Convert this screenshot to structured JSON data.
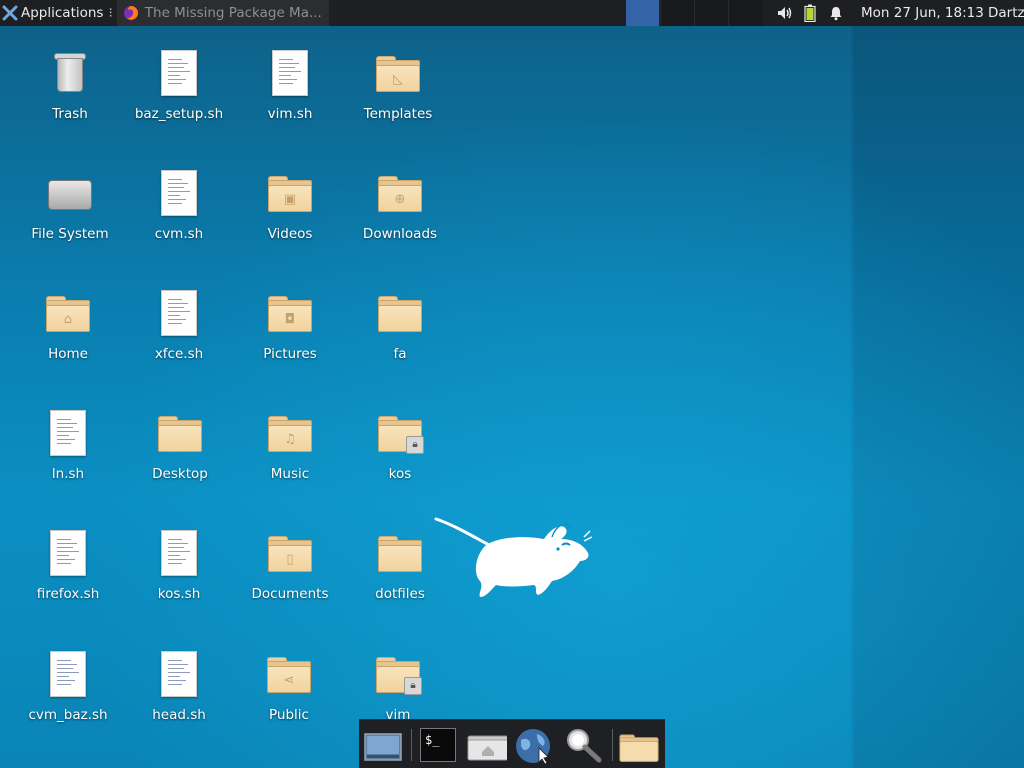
{
  "panel": {
    "applications_label": "Applications",
    "task_title": "The Missing Package Ma...",
    "clock": "Mon 27 Jun, 18:13",
    "user": "Dartz",
    "active_workspace": 1
  },
  "desktop": {
    "icons": {
      "trash": "Trash",
      "baz_setup": "baz_setup.sh",
      "vim_sh": "vim.sh",
      "templates": "Templates",
      "file_system": "File System",
      "cvm_sh": "cvm.sh",
      "videos": "Videos",
      "downloads": "Downloads",
      "home": "Home",
      "xfce_sh": "xfce.sh",
      "pictures": "Pictures",
      "fa": "fa",
      "ln_sh": "ln.sh",
      "desktop": "Desktop",
      "music": "Music",
      "kos": "kos",
      "firefox_sh": "firefox.sh",
      "kos_sh": "kos.sh",
      "documents": "Documents",
      "dotfiles": "dotfiles",
      "cvm_baz_sh": "cvm_baz.sh",
      "head_sh": "head.sh",
      "public": "Public",
      "vim": "vim"
    }
  },
  "dock": {
    "terminal_prompt": "$_"
  },
  "colors": {
    "panel_bg": "#1e1f22",
    "workspace_active": "#3563a8",
    "folder": "#f1d39e",
    "desktop_blue": "#0a84b6"
  }
}
